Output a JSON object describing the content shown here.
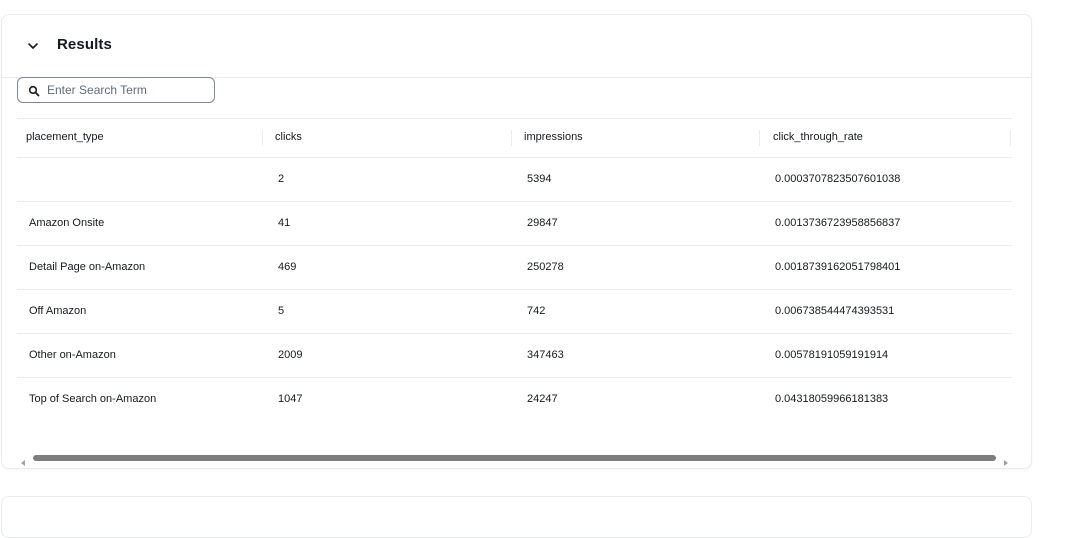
{
  "results_panel": {
    "title": "Results",
    "expand_icon": "chevron-down-icon"
  },
  "search": {
    "placeholder": "Enter Search Term",
    "value": "",
    "icon": "search-icon"
  },
  "table": {
    "columns": [
      "placement_type",
      "clicks",
      "impressions",
      "click_through_rate"
    ],
    "rows": [
      [
        "",
        "2",
        "5394",
        "0.0003707823507601038"
      ],
      [
        "Amazon Onsite",
        "41",
        "29847",
        "0.0013736723958856837"
      ],
      [
        "Detail Page on-Amazon",
        "469",
        "250278",
        "0.0018739162051798401"
      ],
      [
        "Off Amazon",
        "5",
        "742",
        "0.006738544474393531"
      ],
      [
        "Other on-Amazon",
        "2009",
        "347463",
        "0.00578191059191914"
      ],
      [
        "Top of Search on-Amazon",
        "1047",
        "24247",
        "0.04318059966181383"
      ]
    ]
  },
  "colors": {
    "text": "#16191f",
    "border": "#e9ebed",
    "scroll_thumb": "#7d7d7d"
  }
}
